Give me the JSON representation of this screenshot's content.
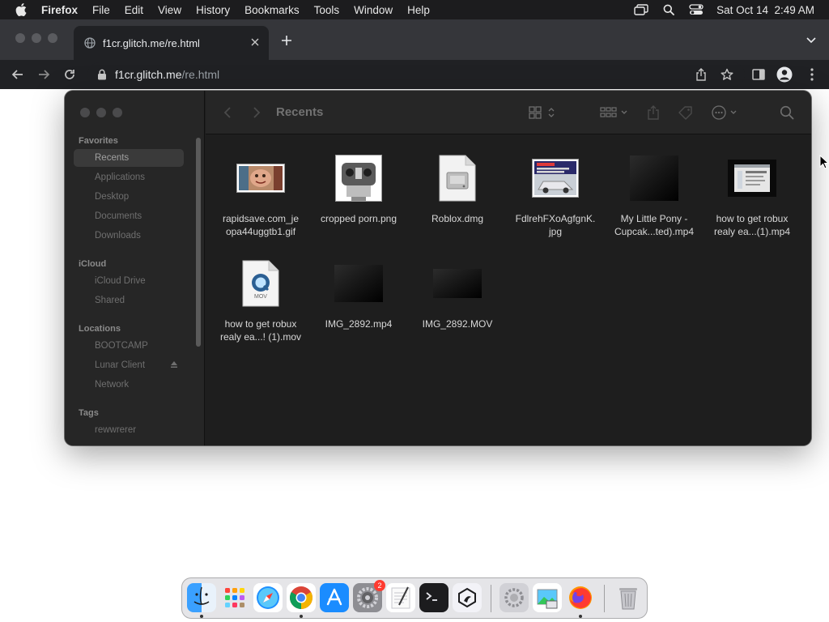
{
  "menubar": {
    "app_name": "Firefox",
    "items": [
      "File",
      "Edit",
      "View",
      "History",
      "Bookmarks",
      "Tools",
      "Window",
      "Help"
    ],
    "clock": "Sat Oct 14  2:49 AM"
  },
  "browser": {
    "tab": {
      "title": "f1cr.glitch.me/re.html"
    },
    "url": {
      "host": "f1cr.glitch.me",
      "path": "/re.html"
    }
  },
  "finder": {
    "title": "Recents",
    "sidebar": {
      "favorites_label": "Favorites",
      "favorites": [
        "Recents",
        "Applications",
        "Desktop",
        "Documents",
        "Downloads"
      ],
      "icloud_label": "iCloud",
      "icloud": [
        "iCloud Drive",
        "Shared"
      ],
      "locations_label": "Locations",
      "locations": [
        "BOOTCAMP",
        "Lunar Client",
        "Network"
      ],
      "tags_label": "Tags",
      "tags": [
        "rewwrerer"
      ]
    },
    "files": [
      {
        "line1": "rapidsave.com_je",
        "line2": "opa44uggtb1.gif",
        "kind": "gif"
      },
      {
        "line1": "cropped porn.png",
        "line2": "",
        "kind": "png"
      },
      {
        "line1": "Roblox.dmg",
        "line2": "",
        "kind": "dmg"
      },
      {
        "line1": "FdlrehFXoAgfgnK.",
        "line2": "jpg",
        "kind": "jpg"
      },
      {
        "line1": "My Little Pony -",
        "line2": "Cupcak...ted).mp4",
        "kind": "video"
      },
      {
        "line1": "how to get robux",
        "line2": "realy ea...(1).mp4",
        "kind": "video-screen"
      },
      {
        "line1": "how to get robux",
        "line2": "realy ea...! (1).mov",
        "kind": "mov",
        "badge": "MOV"
      },
      {
        "line1": "IMG_2892.mp4",
        "line2": "",
        "kind": "video"
      },
      {
        "line1": "IMG_2892.MOV",
        "line2": "",
        "kind": "video"
      }
    ]
  },
  "dock": {
    "apps": [
      "Finder",
      "Launchpad",
      "Safari",
      "Chrome",
      "App Store",
      "System Preferences",
      "TextEdit",
      "Terminal",
      "Lunar Client",
      "Utilities",
      "Preview",
      "Firefox",
      "Trash"
    ],
    "settings_badge": "2"
  }
}
